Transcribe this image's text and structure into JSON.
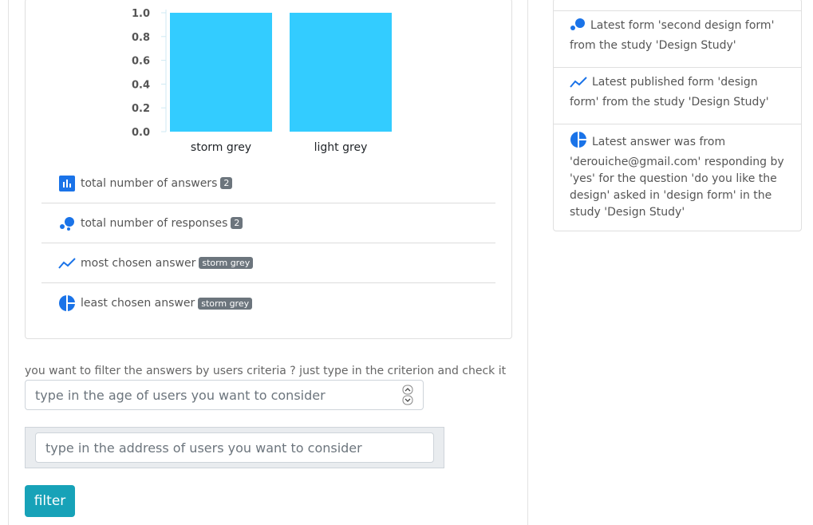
{
  "chart_data": {
    "type": "bar",
    "categories": [
      "storm grey",
      "light grey"
    ],
    "values": [
      1.0,
      1.0
    ],
    "ylim": [
      0,
      1.0
    ],
    "yticks": [
      "0.0",
      "0.2",
      "0.4",
      "0.6",
      "0.8",
      "1.0"
    ],
    "bar_color": "#33ccff",
    "grid": false
  },
  "stats": [
    {
      "icon": "bar-chart-icon",
      "label": "total number of answers",
      "badge": "2"
    },
    {
      "icon": "bubbles-icon",
      "label": "total number of responses",
      "badge": "2"
    },
    {
      "icon": "trend-line-icon",
      "label": "most chosen answer",
      "badge": "storm grey"
    },
    {
      "icon": "pie-chart-icon",
      "label": "least chosen answer",
      "badge": "storm grey"
    }
  ],
  "filter": {
    "instructions": "you want to filter the answers by users criteria ? just type in the criterion and check it",
    "age_placeholder": "type in the age of users you want to consider",
    "address_placeholder": "type in the address of users you want to consider",
    "button_label": "filter"
  },
  "activity": [
    {
      "icon": "bubbles-icon",
      "text": "Latest form 'second design form' from the study 'Design Study'"
    },
    {
      "icon": "trend-line-icon",
      "text": "Latest published form 'design form' from the study 'Design Study'"
    },
    {
      "icon": "pie-chart-icon",
      "text": "Latest answer was from 'derouiche@gmail.com' responding by 'yes' for the question 'do you like the design' asked in 'design form' in the study 'Design Study'"
    }
  ],
  "colors": {
    "accent": "#1a73e8",
    "badge": "#6c757d",
    "button": "#17a2b8"
  }
}
